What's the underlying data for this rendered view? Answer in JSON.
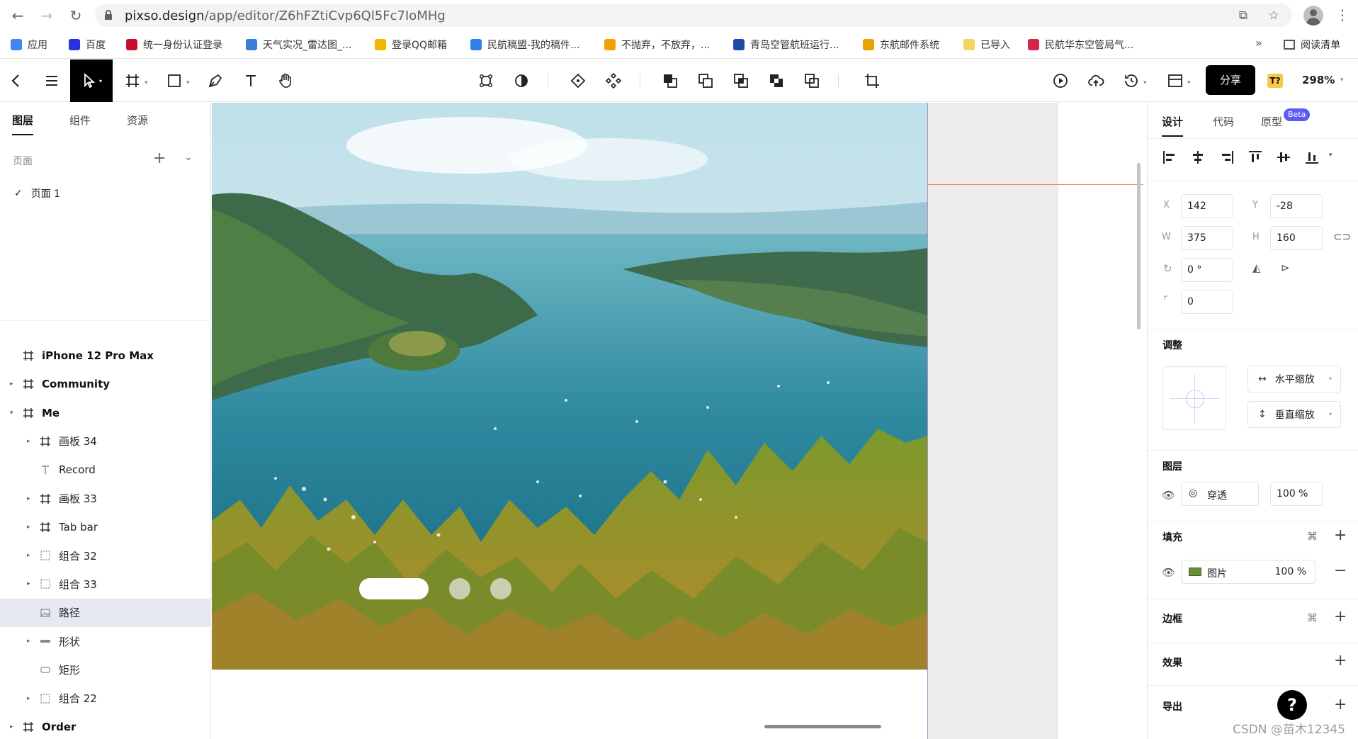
{
  "browser": {
    "url_host": "pixso.design",
    "url_path": "/app/editor/Z6hFZtiCvp6Ql5Fc7IoMHg",
    "bookmarks": [
      {
        "label": "应用",
        "color": "#4285f4"
      },
      {
        "label": "百度",
        "color": "#2932e1"
      },
      {
        "label": "统一身份认证登录",
        "color": "#c8102e"
      },
      {
        "label": "天气实况_雷达图_...",
        "color": "#3b7dd8"
      },
      {
        "label": "登录QQ邮箱",
        "color": "#f4b400"
      },
      {
        "label": "民航稿盟-我的稿件...",
        "color": "#2f80ed"
      },
      {
        "label": "不抛弃，不放弃，...",
        "color": "#f2a100"
      },
      {
        "label": "青岛空管航班运行...",
        "color": "#1f4aa8"
      },
      {
        "label": "东航邮件系统",
        "color": "#e8a300"
      },
      {
        "label": "已导入",
        "color": "#f7d360"
      },
      {
        "label": "民航华东空管局气...",
        "color": "#d0264b"
      }
    ],
    "more": "»",
    "reading_list": "阅读清单"
  },
  "toolbar": {
    "share": "分享",
    "badge": "T?",
    "zoom": "298%"
  },
  "left_panel": {
    "tabs": [
      "图层",
      "组件",
      "资源"
    ],
    "pages_header": "页面",
    "current_page": "页面 1",
    "layers": [
      {
        "name": "iPhone 12 Pro Max",
        "level": 0,
        "expand": "",
        "icon": "frame"
      },
      {
        "name": "Community",
        "level": 0,
        "expand": "▸",
        "icon": "frame"
      },
      {
        "name": "Me",
        "level": 0,
        "expand": "▾",
        "icon": "frame"
      },
      {
        "name": "画板 34",
        "level": 1,
        "expand": "▸",
        "icon": "frame"
      },
      {
        "name": "Record",
        "level": 1,
        "expand": "",
        "icon": "text"
      },
      {
        "name": "画板 33",
        "level": 1,
        "expand": "▸",
        "icon": "frame"
      },
      {
        "name": "Tab bar",
        "level": 1,
        "expand": "▸",
        "icon": "frame"
      },
      {
        "name": "组合 32",
        "level": 1,
        "expand": "▸",
        "icon": "group"
      },
      {
        "name": "组合 33",
        "level": 1,
        "expand": "▸",
        "icon": "group"
      },
      {
        "name": "路径",
        "level": 1,
        "expand": "",
        "icon": "image",
        "selected": true
      },
      {
        "name": "形状",
        "level": 1,
        "expand": "▸",
        "icon": "shape"
      },
      {
        "name": "矩形",
        "level": 1,
        "expand": "",
        "icon": "rect"
      },
      {
        "name": "组合 22",
        "level": 1,
        "expand": "▸",
        "icon": "group"
      },
      {
        "name": "Order",
        "level": 0,
        "expand": "▸",
        "icon": "frame"
      }
    ]
  },
  "right_panel": {
    "tabs": [
      "设计",
      "代码",
      "原型"
    ],
    "beta": "Beta",
    "x_label": "X",
    "x": "142",
    "y_label": "Y",
    "y": "-28",
    "w_label": "W",
    "w": "375",
    "h_label": "H",
    "h": "160",
    "rotation": "0 °",
    "radius": "0",
    "adjust_title": "调整",
    "h_scale": "水平缩放",
    "v_scale": "垂直缩放",
    "layer_title": "图层",
    "blend": "穿透",
    "layer_opacity": "100 %",
    "fill_title": "填充",
    "fill_type": "图片",
    "fill_opacity": "100 %",
    "stroke_title": "边框",
    "effect_title": "效果",
    "export_title": "导出",
    "help": "?",
    "watermark": "CSDN @苗木12345"
  }
}
